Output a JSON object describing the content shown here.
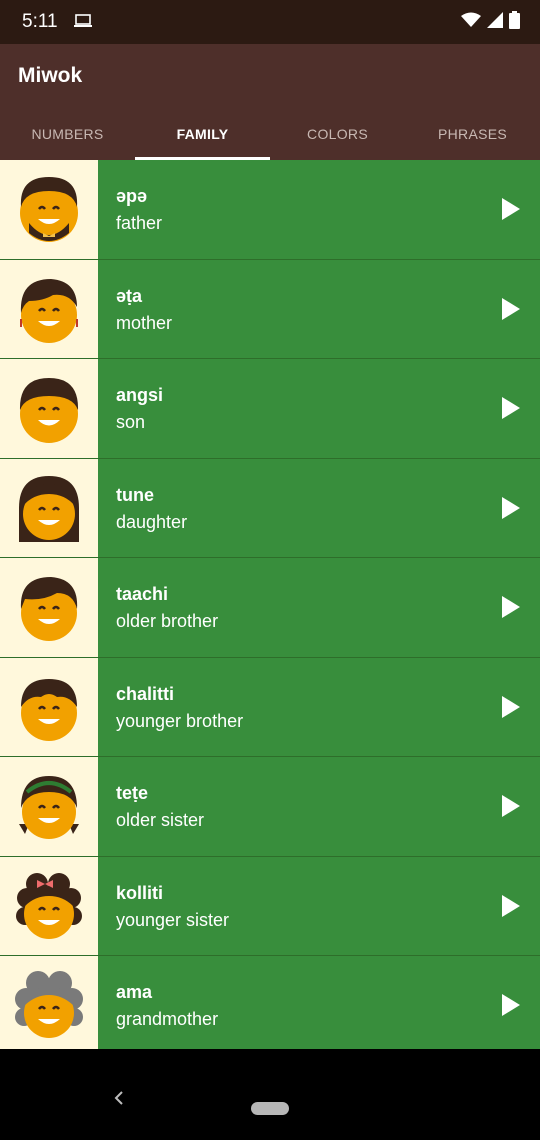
{
  "status": {
    "time": "5:11"
  },
  "app": {
    "title": "Miwok"
  },
  "tabs": [
    {
      "label": "NUMBERS",
      "active": false
    },
    {
      "label": "FAMILY",
      "active": true
    },
    {
      "label": "COLORS",
      "active": false
    },
    {
      "label": "PHRASES",
      "active": false
    }
  ],
  "items": [
    {
      "miwok": "əpə",
      "english": "father",
      "icon": "father-avatar-icon"
    },
    {
      "miwok": "əṭa",
      "english": "mother",
      "icon": "mother-avatar-icon"
    },
    {
      "miwok": "angsi",
      "english": "son",
      "icon": "son-avatar-icon"
    },
    {
      "miwok": "tune",
      "english": "daughter",
      "icon": "daughter-avatar-icon"
    },
    {
      "miwok": "taachi",
      "english": "older brother",
      "icon": "older-brother-avatar-icon"
    },
    {
      "miwok": "chalitti",
      "english": "younger brother",
      "icon": "younger-brother-avatar-icon"
    },
    {
      "miwok": "teṭe",
      "english": "older sister",
      "icon": "older-sister-avatar-icon"
    },
    {
      "miwok": "kolliti",
      "english": "younger sister",
      "icon": "younger-sister-avatar-icon"
    },
    {
      "miwok": "ama",
      "english": "grandmother",
      "icon": "grandmother-avatar-icon"
    }
  ],
  "colors": {
    "app_bar": "#4e2f2a",
    "status_bar": "#2c1a12",
    "row_green": "#388e3c",
    "avatar_bg": "#fff8dc",
    "face": "#f2a100",
    "hair": "#3a2418"
  }
}
